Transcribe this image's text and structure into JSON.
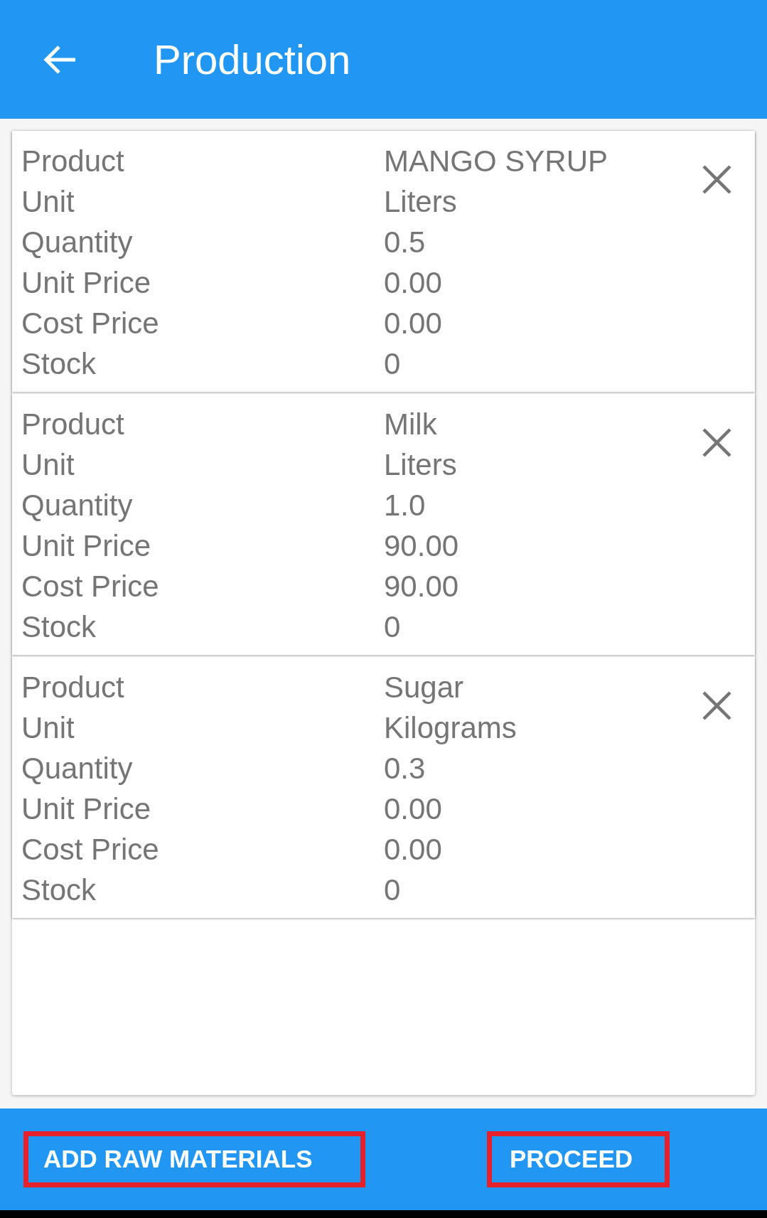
{
  "app_bar": {
    "title": "Production"
  },
  "materials": [
    {
      "fields": [
        {
          "label": "Product",
          "value": "MANGO SYRUP"
        },
        {
          "label": "Unit",
          "value": "Liters"
        },
        {
          "label": "Quantity",
          "value": "0.5"
        },
        {
          "label": "Unit Price",
          "value": "0.00"
        },
        {
          "label": "Cost Price",
          "value": "0.00"
        },
        {
          "label": "Stock",
          "value": "0"
        }
      ]
    },
    {
      "fields": [
        {
          "label": "Product",
          "value": "Milk"
        },
        {
          "label": "Unit",
          "value": "Liters"
        },
        {
          "label": "Quantity",
          "value": "1.0"
        },
        {
          "label": "Unit Price",
          "value": "90.00"
        },
        {
          "label": "Cost Price",
          "value": "90.00"
        },
        {
          "label": "Stock",
          "value": "0"
        }
      ]
    },
    {
      "fields": [
        {
          "label": "Product",
          "value": "Sugar"
        },
        {
          "label": "Unit",
          "value": "Kilograms"
        },
        {
          "label": "Quantity",
          "value": "0.3"
        },
        {
          "label": "Unit Price",
          "value": "0.00"
        },
        {
          "label": "Cost Price",
          "value": "0.00"
        },
        {
          "label": "Stock",
          "value": "0"
        }
      ]
    }
  ],
  "actions": [
    {
      "label": "ADD RAW MATERIALS",
      "highlighted": true
    },
    {
      "label": "PROCEED",
      "highlighted": true
    }
  ]
}
